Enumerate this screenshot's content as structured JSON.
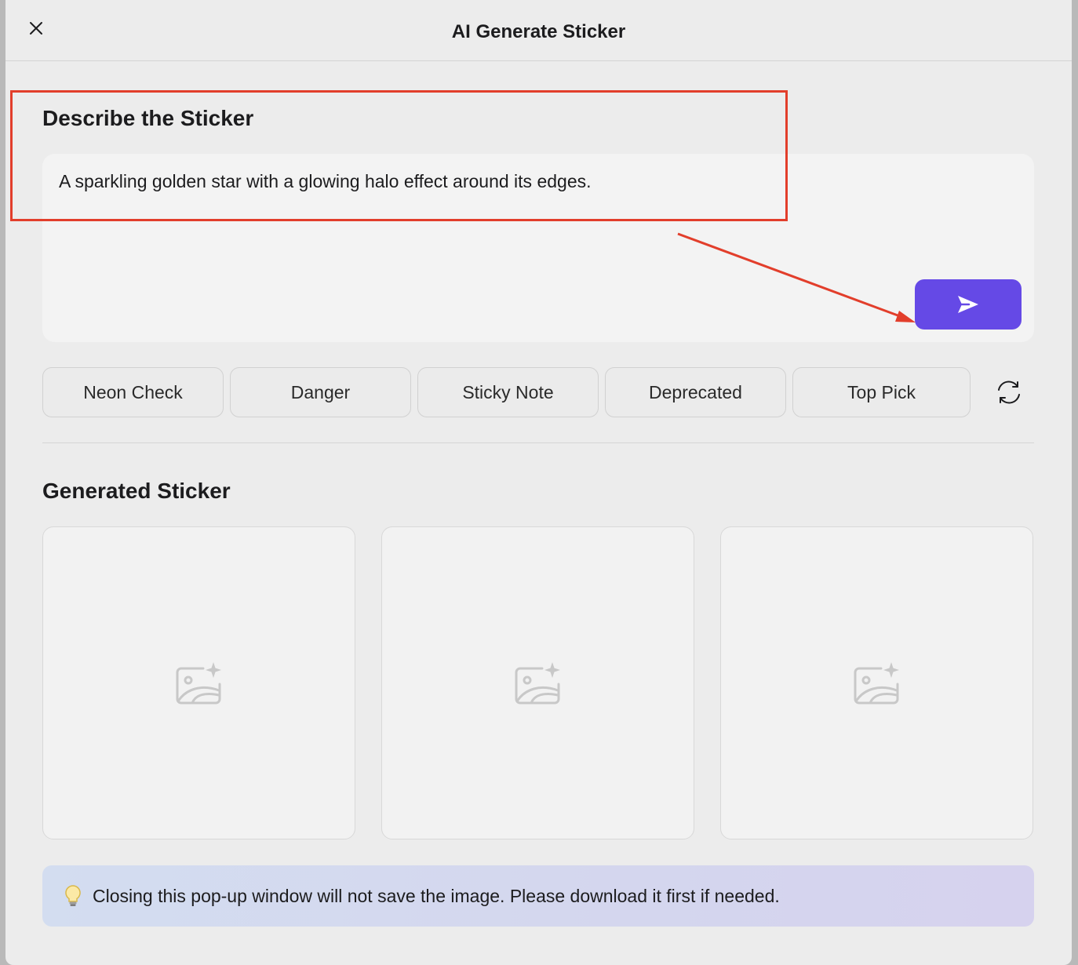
{
  "dialog": {
    "title": "AI Generate Sticker",
    "close_icon": "close-icon"
  },
  "describe": {
    "heading": "Describe the Sticker",
    "prompt_value": "A sparkling golden star with a glowing halo effect around its edges.",
    "send_icon": "send-icon",
    "send_color": "#6549e6"
  },
  "presets": {
    "items": [
      {
        "label": "Neon Check"
      },
      {
        "label": "Danger"
      },
      {
        "label": "Sticky Note"
      },
      {
        "label": "Deprecated"
      },
      {
        "label": "Top Pick"
      }
    ],
    "refresh_icon": "refresh-icon"
  },
  "generated": {
    "heading": "Generated Sticker",
    "placeholder_icon": "image-sparkle-icon"
  },
  "notice": {
    "icon": "lightbulb-icon",
    "text": "Closing this pop-up window will not save the image. Please download it first if needed."
  },
  "annotation": {
    "highlight_color": "#e23e2b"
  }
}
